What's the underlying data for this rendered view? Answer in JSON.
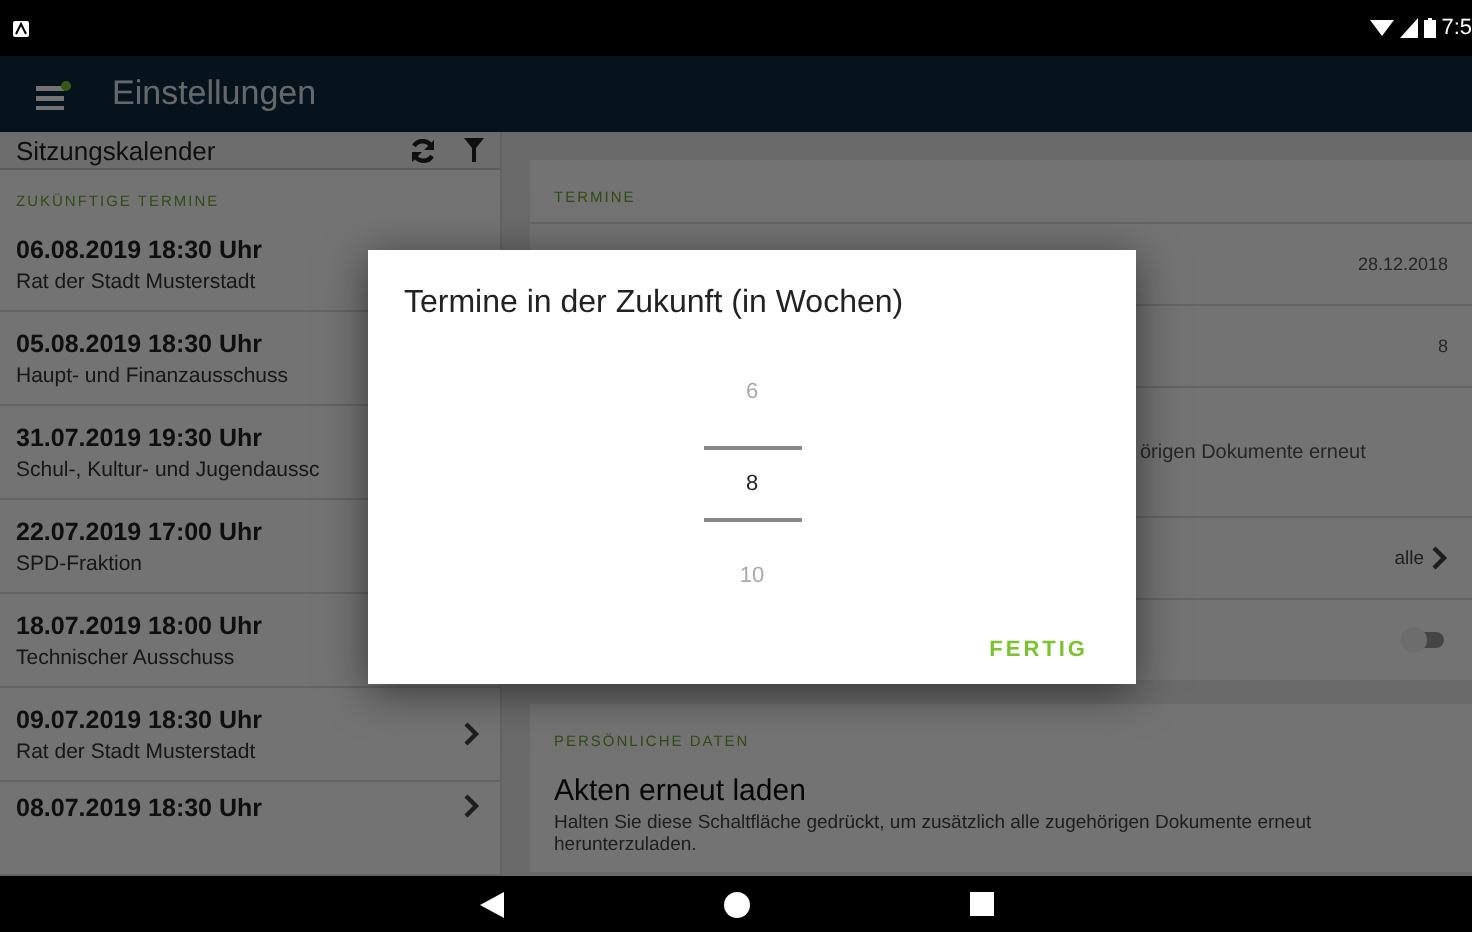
{
  "status_bar": {
    "time": "7:5"
  },
  "app_bar": {
    "title": "Einstellungen"
  },
  "calendar": {
    "title": "Sitzungskalender",
    "section": "ZUKÜNFTIGE TERMINE",
    "items": [
      {
        "date": "06.08.2019 18:30 Uhr",
        "name": "Rat der Stadt Musterstadt"
      },
      {
        "date": "05.08.2019 18:30 Uhr",
        "name": "Haupt- und Finanzausschuss"
      },
      {
        "date": "31.07.2019 19:30 Uhr",
        "name": "Schul-, Kultur- und Jugendaussc"
      },
      {
        "date": "22.07.2019 17:00 Uhr",
        "name": "SPD-Fraktion"
      },
      {
        "date": "18.07.2019 18:00 Uhr",
        "name": "Technischer Ausschuss"
      },
      {
        "date": "09.07.2019 18:30 Uhr",
        "name": "Rat der Stadt Musterstadt"
      },
      {
        "date": "08.07.2019 18:30 Uhr"
      }
    ]
  },
  "settings": {
    "termine": {
      "header": "TERMINE",
      "rows": [
        {
          "kind": "value",
          "value": "28.12.2018"
        },
        {
          "kind": "value",
          "value": "8"
        },
        {
          "kind": "text",
          "text": "örigen Dokumente erneut"
        },
        {
          "kind": "link",
          "value": "alle"
        },
        {
          "kind": "toggle",
          "on": false
        }
      ]
    },
    "personal": {
      "header": "PERSÖNLICHE DATEN",
      "title": "Akten erneut laden",
      "description": "Halten Sie diese Schaltfläche gedrückt, um zusätzlich alle zugehörigen Dokumente erneut herunterzuladen."
    }
  },
  "dialog": {
    "title": "Termine in der Zukunft (in Wochen)",
    "options": [
      {
        "label": "6",
        "selected": false
      },
      {
        "label": "8",
        "selected": true
      },
      {
        "label": "10",
        "selected": false
      }
    ],
    "button": "FERTIG"
  }
}
